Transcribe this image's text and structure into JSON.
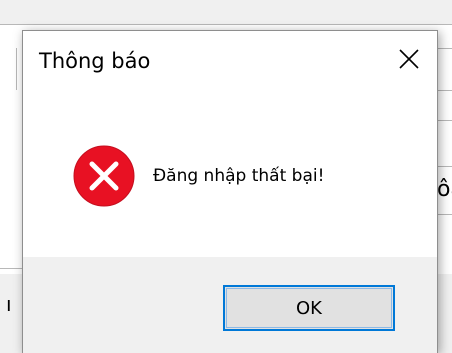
{
  "dialog": {
    "title": "Thông báo",
    "message": "Đăng nhập thất bại!",
    "ok_label": "OK",
    "close_icon": "close-icon",
    "message_icon": "error-icon"
  },
  "background": {
    "partial_text_right": "ôa",
    "partial_text_left": "ı"
  },
  "colors": {
    "error_red": "#e81123",
    "button_focus_border": "#0078d7",
    "button_face": "#e1e1e1",
    "footer_bg": "#f0f0f0"
  }
}
